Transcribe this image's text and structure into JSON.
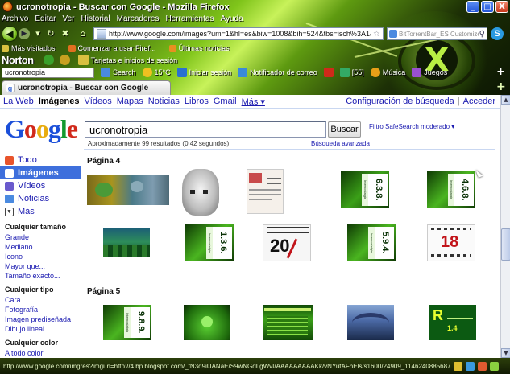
{
  "window": {
    "title": "ucronotropia - Buscar con Google - Mozilla Firefox",
    "buttons": [
      "_",
      "□",
      "X"
    ]
  },
  "menu": [
    "Archivo",
    "Editar",
    "Ver",
    "Historial",
    "Marcadores",
    "Herramientas",
    "Ayuda"
  ],
  "navbar": {
    "url": "http://www.google.com/images?um=1&hl=es&biw=1008&bih=524&tbs=isch%3A1&sa=1&q=ucronotro",
    "search_placeholder": "BitTorrentBar_ES Customized"
  },
  "bookmarks": [
    {
      "label": "Más visitados",
      "color": "#d8c040"
    },
    {
      "label": "Comenzar a usar Firef...",
      "color": "#e06f1f"
    },
    {
      "label": "Últimas noticias",
      "color": "#e89020"
    }
  ],
  "norton": {
    "brand": "Norton",
    "cards_label": "Tarjetas e inicios de sesión"
  },
  "toolbar2": {
    "search_input": "ucronotropia",
    "items": [
      {
        "label": "Search",
        "color": "#4a8ae0"
      },
      {
        "label": "15°C",
        "color": "#f0c020"
      },
      {
        "label": "Iniciar sesión",
        "color": "#2a70d0"
      },
      {
        "label": "Notificador de correo",
        "color": "#3a8ad8"
      },
      {
        "label": "[55]",
        "color": "#3a6"
      },
      {
        "label": "Música",
        "color": "#e8a018"
      },
      {
        "label": "Juegos",
        "color": "#9a50d0"
      }
    ]
  },
  "tab": {
    "label": "ucronotropia - Buscar con Google"
  },
  "gbar": {
    "links": [
      "La Web",
      "Imágenes",
      "Vídeos",
      "Mapas",
      "Noticias",
      "Libros",
      "Gmail",
      "Más ▾"
    ],
    "active": 1,
    "settings": "Configuración de búsqueda",
    "signin": "Acceder"
  },
  "logo_letters": [
    "G",
    "o",
    "o",
    "g",
    "l",
    "e"
  ],
  "search": {
    "query": "ucronotropia",
    "button": "Buscar",
    "safesearch": "Filtro SafeSearch moderado ▾",
    "stats": "Aproximadamente 99 resultados (0.42 segundos)",
    "advanced": "Búsqueda avanzada"
  },
  "sidebar": {
    "types": [
      {
        "label": "Todo",
        "icon": "#e8542c"
      },
      {
        "label": "Imágenes",
        "icon": "#fff"
      },
      {
        "label": "Vídeos",
        "icon": "#6a5acd"
      },
      {
        "label": "Noticias",
        "icon": "#4a8ae0"
      },
      {
        "label": "Más",
        "icon": "#444"
      }
    ],
    "active": 1,
    "size_header": "Cualquier tamaño",
    "sizes": [
      "Grande",
      "Mediano",
      "Icono",
      "Mayor que...",
      "Tamaño exacto..."
    ],
    "type_header": "Cualquier tipo",
    "kinds": [
      "Cara",
      "Fotografía",
      "Imagen prediseñada",
      "Dibujo lineal"
    ],
    "color_header": "Cualquier color",
    "colors": [
      "A todo color"
    ]
  },
  "results": {
    "page4": "Página 4",
    "page5": "Página 5",
    "row1_icons": [
      "image-thumb",
      "image-thumb",
      "image-thumb",
      "image-thumb",
      "image-thumb"
    ],
    "row2_icons": [
      "image-thumb",
      "image-thumb",
      "image-thumb",
      "image-thumb",
      "image-thumb"
    ],
    "row3_icons": [
      "image-thumb",
      "image-thumb",
      "image-thumb",
      "image-thumb",
      "image-thumb"
    ],
    "vertical_texts": [
      "Internostalgia",
      "Internostalgia",
      "Internostalgia",
      "Internostalgia",
      "Internostalgia"
    ],
    "big_numbers": [
      "6.3.8.",
      "4.6.8.",
      "1.3.6.",
      "5.9.4.",
      "9.8.9."
    ],
    "calendar_digits": [
      "20",
      "18"
    ],
    "row3_bottom_text": "1.4"
  },
  "status": {
    "text": "http://www.google.com/imgres?imgurl=http://4.bp.blogspot.com/_fN3d9iUANaE/S9wNGdLgWvI/AAAAAAAAAKk/vNYutAFhEls/s1600/24909_114624088568726_100000634137684_144648_6544695..."
  }
}
